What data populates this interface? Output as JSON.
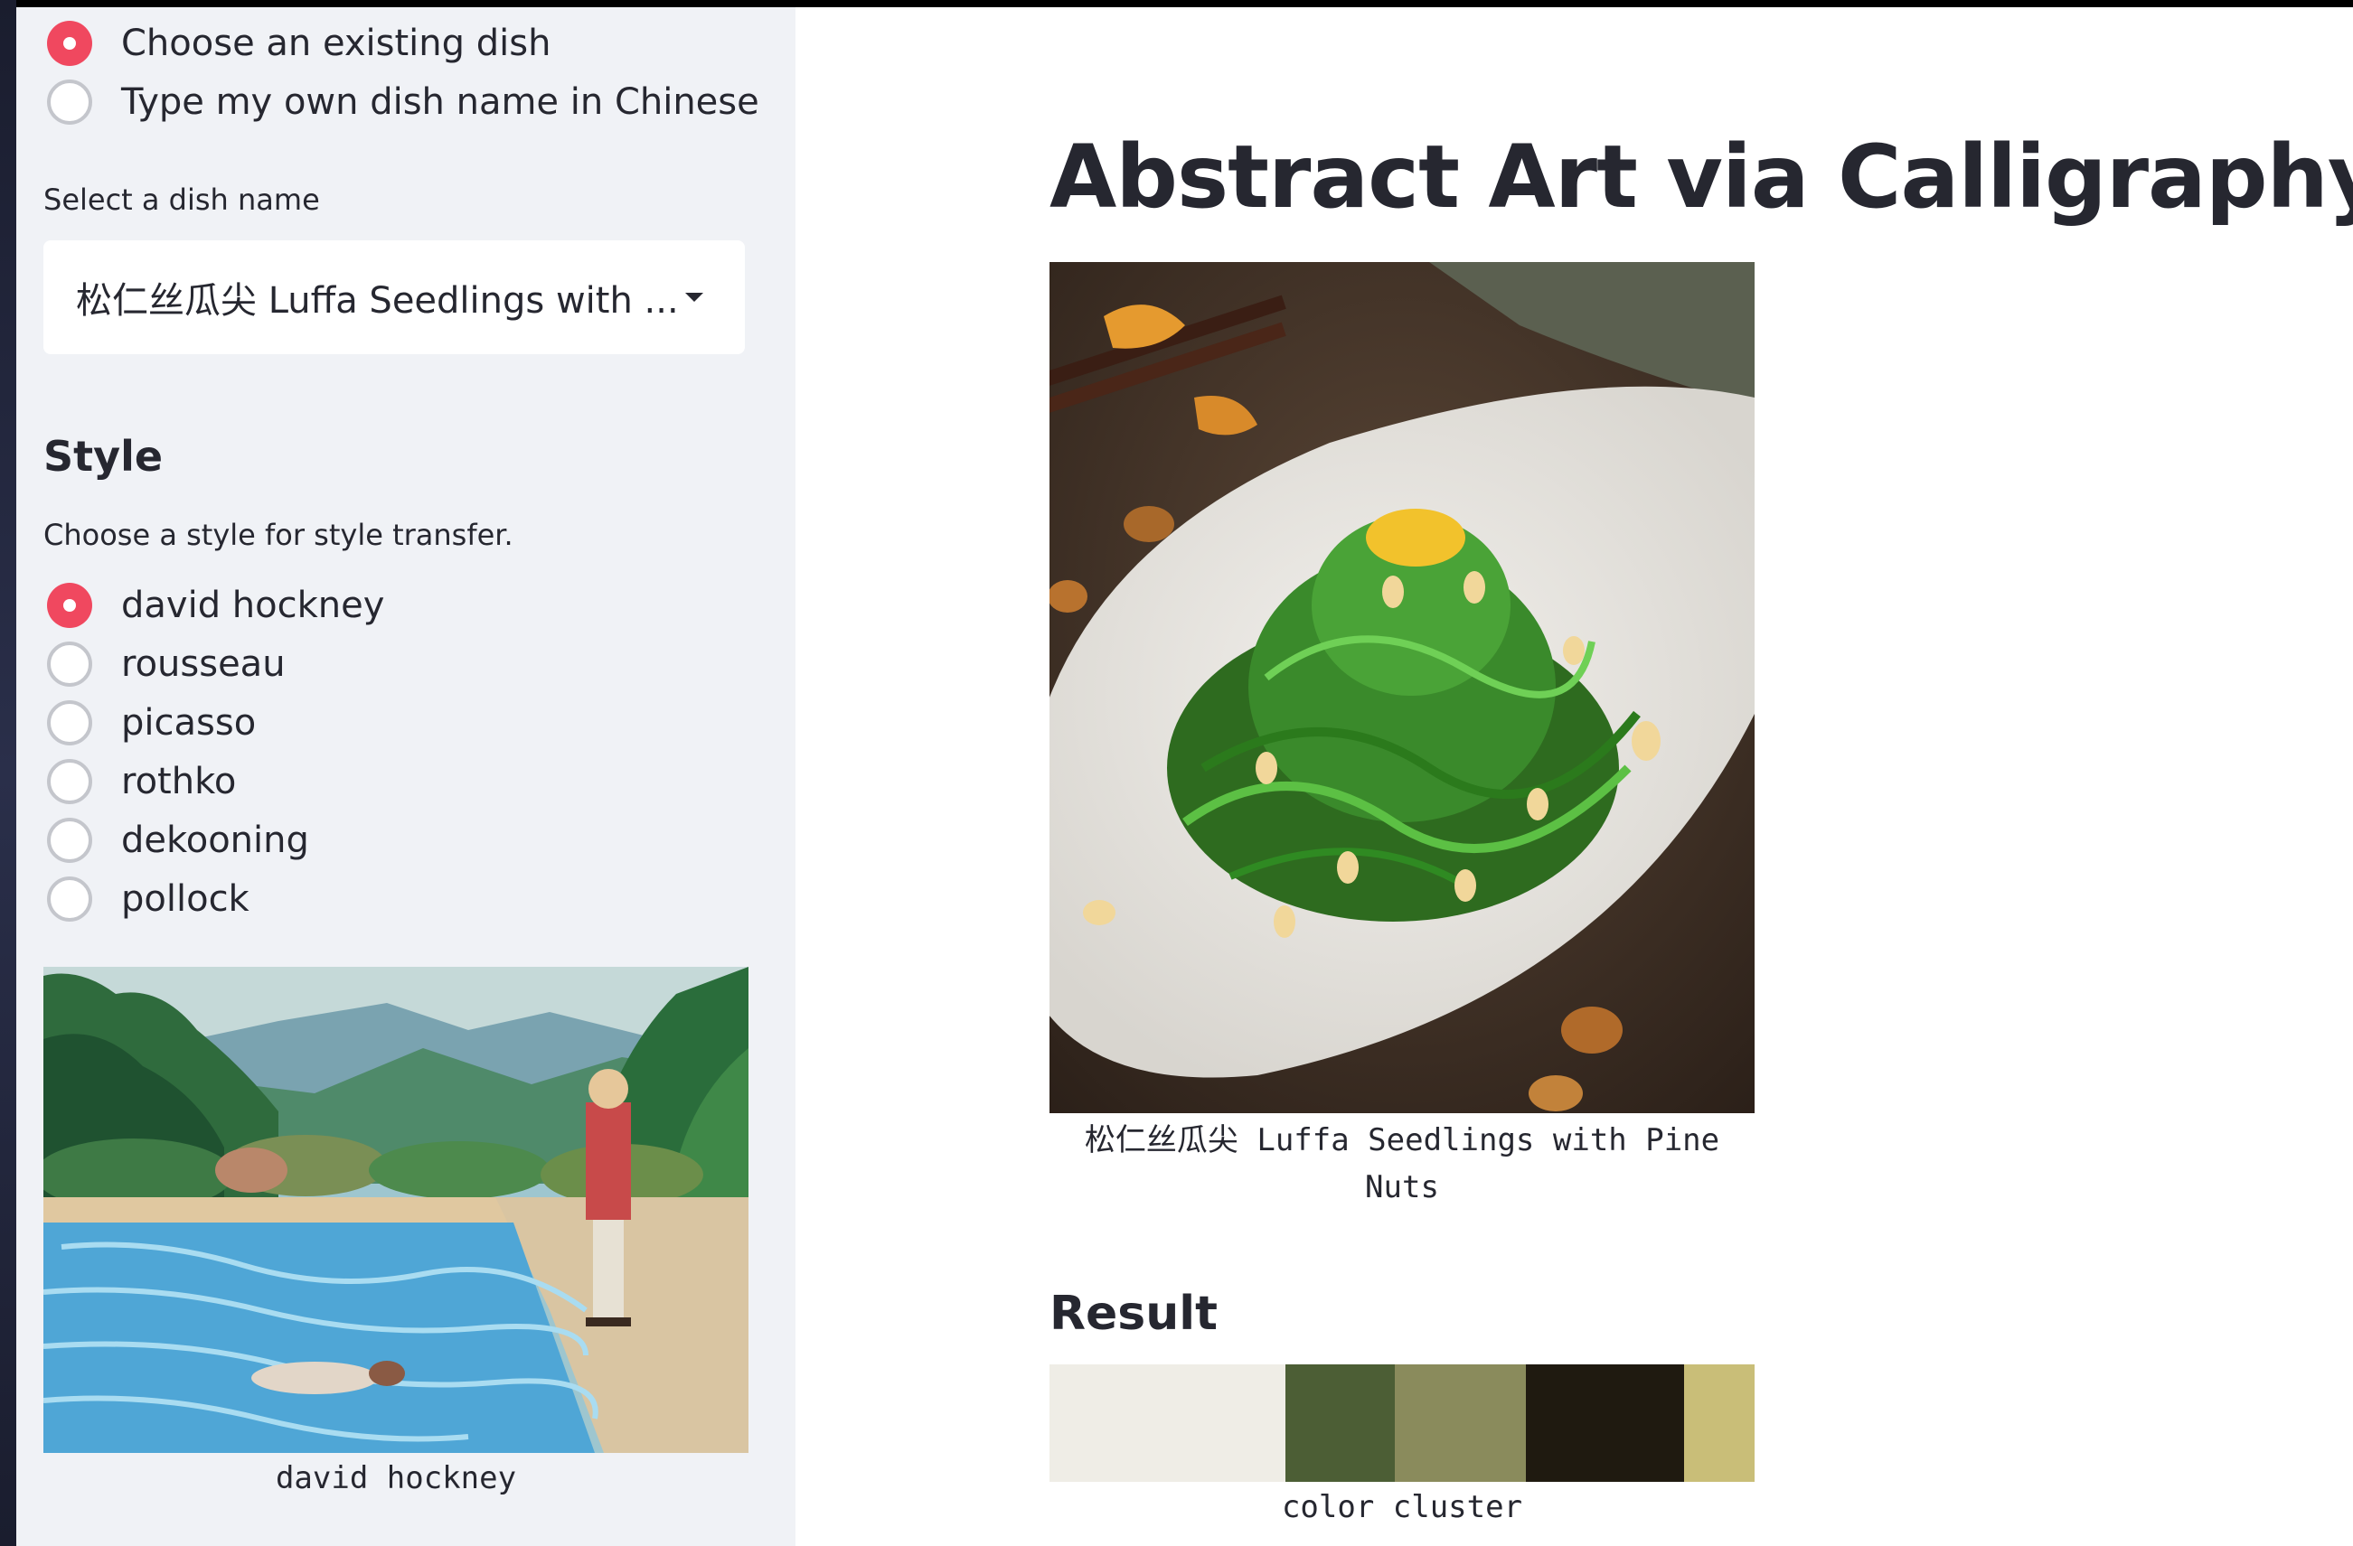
{
  "sidebar": {
    "input_mode": {
      "options": [
        {
          "label": "Choose an existing dish",
          "checked": true
        },
        {
          "label": "Type my own dish name in Chinese",
          "checked": false
        }
      ]
    },
    "dish_select": {
      "label": "Select a dish name",
      "value": "松仁丝瓜尖 Luffa Seedlings with ..."
    },
    "style": {
      "heading": "Style",
      "description": "Choose a style for style transfer.",
      "options": [
        {
          "label": "david hockney",
          "checked": true
        },
        {
          "label": "rousseau",
          "checked": false
        },
        {
          "label": "picasso",
          "checked": false
        },
        {
          "label": "rothko",
          "checked": false
        },
        {
          "label": "dekooning",
          "checked": false
        },
        {
          "label": "pollock",
          "checked": false
        }
      ],
      "image_caption": "david hockney"
    }
  },
  "main": {
    "title": "Abstract Art via CalligraphyGAN",
    "dish_image_caption": "松仁丝瓜尖 Luffa Seedlings with Pine Nuts",
    "result_heading": "Result",
    "palette_caption": "color cluster",
    "palette": [
      {
        "color": "#efede6",
        "share": 0.335
      },
      {
        "color": "#4c5e35",
        "share": 0.155
      },
      {
        "color": "#8a8b5c",
        "share": 0.185
      },
      {
        "color": "#1f1a10",
        "share": 0.225
      },
      {
        "color": "#c9be78",
        "share": 0.1
      }
    ]
  },
  "colors": {
    "accent": "#f0485f",
    "sidebar_bg": "#f0f2f6",
    "text": "#262730"
  }
}
